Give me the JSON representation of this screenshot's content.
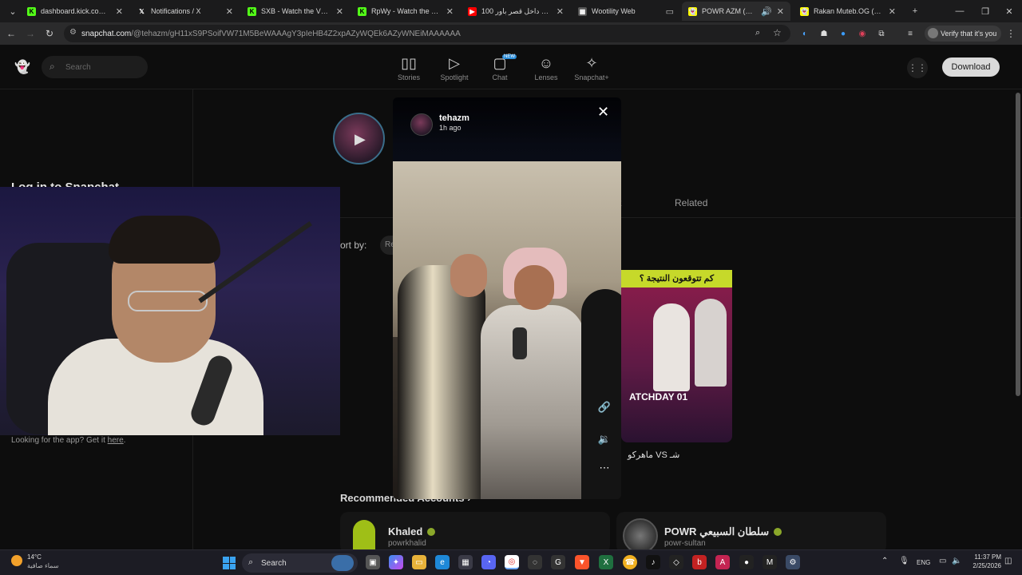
{
  "browser": {
    "tabs": [
      {
        "label": "dashboard.kick.com/strea",
        "icon": "kick-icon",
        "color": "#53fc18"
      },
      {
        "label": "Notifications / X",
        "icon": "x-icon",
        "color": "#ffffff"
      },
      {
        "label": "SXB - Watch the VOD on",
        "icon": "kick-icon",
        "color": "#53fc18"
      },
      {
        "label": "RpWy - Watch the VOD o",
        "icon": "kick-icon",
        "color": "#53fc18"
      },
      {
        "label": "100 يوتيوبر داخل قصر باور",
        "icon": "youtube-icon",
        "color": "#ff0000"
      },
      {
        "label": "Wootility Web",
        "icon": "wooting-icon",
        "color": "#888888"
      },
      {
        "label": "POWR AZM (@tehaz",
        "icon": "snapchat-icon",
        "color": "#fffc00"
      },
      {
        "label": "Rakan Muteb.OG (@rms",
        "icon": "snapchat-icon",
        "color": "#fffc00"
      }
    ],
    "url_host": "snapchat.com",
    "url_path": "/@tehazm/gH11xS9PSoifVW71M5BeWAAAgY3pIeHB4Z2xpAZyWQEk6AZyWNEiMAAAAAA",
    "verify_label": "Verify that it's you"
  },
  "snapchat": {
    "search_placeholder": "Search",
    "nav": [
      {
        "label": "Stories",
        "icon": "stories-icon"
      },
      {
        "label": "Spotlight",
        "icon": "spotlight-icon"
      },
      {
        "label": "Chat",
        "icon": "chat-icon",
        "badge": "NEW"
      },
      {
        "label": "Lenses",
        "icon": "lenses-icon"
      },
      {
        "label": "Snapchat+",
        "icon": "snapchat-plus-icon"
      }
    ],
    "download_label": "Download",
    "login_text": "Log in to Snapchat",
    "get_app_prefix": "Looking for the app? Get it ",
    "get_app_link": "here",
    "tabs": {
      "partial": "t",
      "related": "Related"
    },
    "sort_label": "ort by:",
    "sort_value": "Re",
    "thumb_banner": "كم تتوقعون النتيجة ؟",
    "thumb_title": "ماهركو VS شـ",
    "recommended_title": "Recommended Accounts",
    "recommended": [
      {
        "name": "Khaled",
        "username": "powrkhalid"
      },
      {
        "name": "POWR سلطان السبيعي",
        "username": "powr-sultan"
      }
    ]
  },
  "story": {
    "username": "tehazm",
    "time": "1h ago"
  },
  "taskbar": {
    "temperature": "14°C",
    "weather": "سماء صافية",
    "search_label": "Search",
    "lang": "ENG",
    "time": "11:37 PM",
    "date": "2/25/2026"
  }
}
